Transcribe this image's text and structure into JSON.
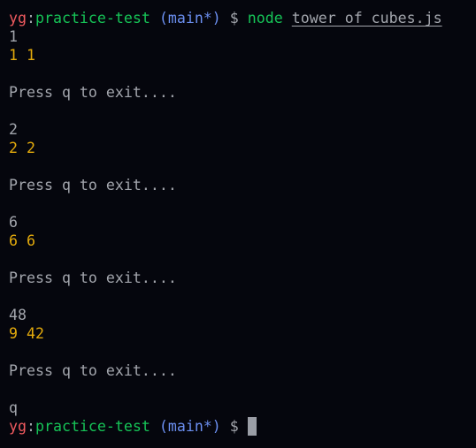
{
  "prompt": {
    "user": "yg",
    "sep": ":",
    "dir": "practice-test",
    "branch": "(main*)",
    "symbol": "$"
  },
  "command": {
    "name": "node",
    "arg": "tower of cubes.js"
  },
  "output": [
    {
      "input": "1",
      "result": "1 1"
    },
    {
      "input": "2",
      "result": "2 2"
    },
    {
      "input": "6",
      "result": "6 6"
    },
    {
      "input": "48",
      "result": "9 42"
    }
  ],
  "exit_message": "Press q to exit....",
  "final_input": "q",
  "colors": {
    "user": "#ef5a5f",
    "dir": "#16c457",
    "branch": "#6b8ff0",
    "text": "#a3a6ad",
    "result": "#e3aa0c",
    "background": "#05060d"
  }
}
